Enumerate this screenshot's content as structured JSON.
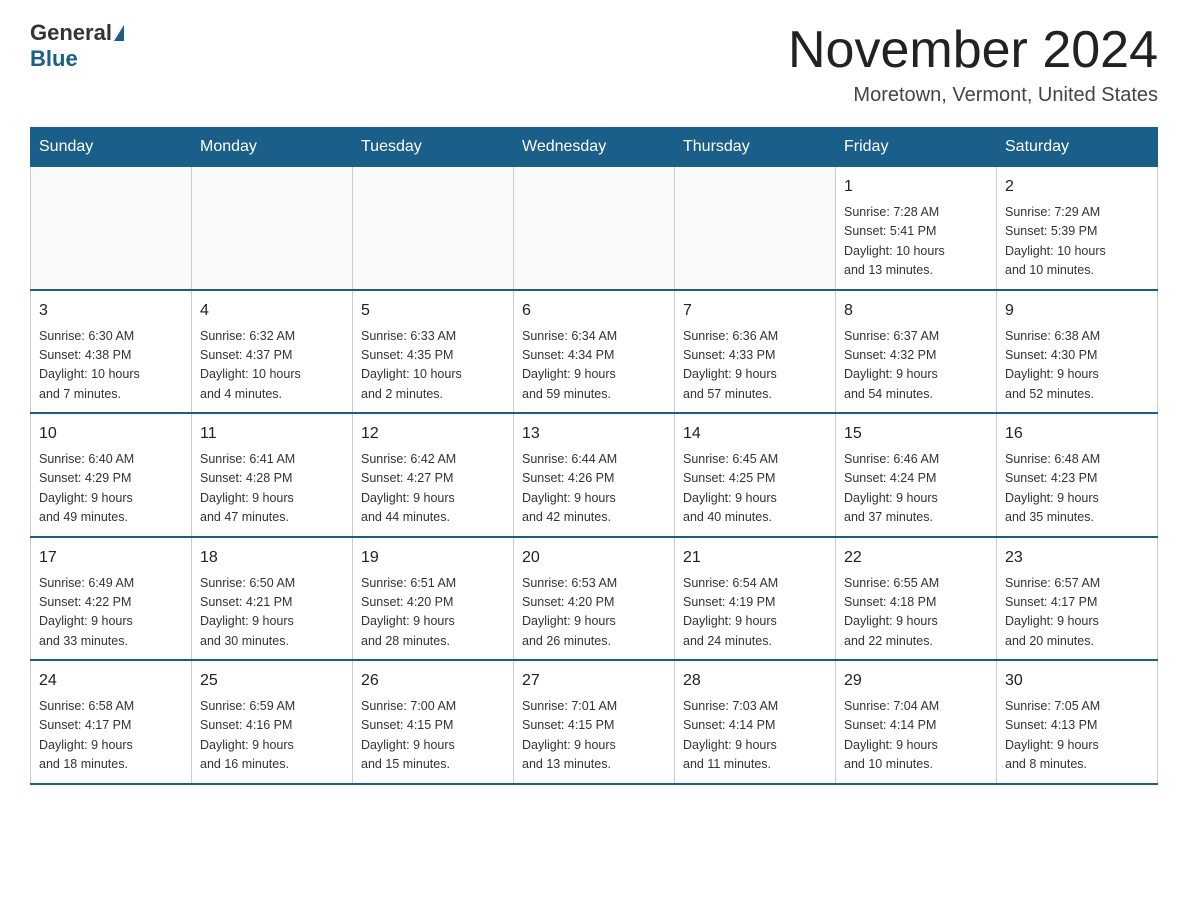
{
  "header": {
    "logo": {
      "general": "General",
      "blue": "Blue"
    },
    "title": "November 2024",
    "location": "Moretown, Vermont, United States"
  },
  "weekdays": [
    "Sunday",
    "Monday",
    "Tuesday",
    "Wednesday",
    "Thursday",
    "Friday",
    "Saturday"
  ],
  "weeks": [
    [
      {
        "day": "",
        "info": ""
      },
      {
        "day": "",
        "info": ""
      },
      {
        "day": "",
        "info": ""
      },
      {
        "day": "",
        "info": ""
      },
      {
        "day": "",
        "info": ""
      },
      {
        "day": "1",
        "info": "Sunrise: 7:28 AM\nSunset: 5:41 PM\nDaylight: 10 hours\nand 13 minutes."
      },
      {
        "day": "2",
        "info": "Sunrise: 7:29 AM\nSunset: 5:39 PM\nDaylight: 10 hours\nand 10 minutes."
      }
    ],
    [
      {
        "day": "3",
        "info": "Sunrise: 6:30 AM\nSunset: 4:38 PM\nDaylight: 10 hours\nand 7 minutes."
      },
      {
        "day": "4",
        "info": "Sunrise: 6:32 AM\nSunset: 4:37 PM\nDaylight: 10 hours\nand 4 minutes."
      },
      {
        "day": "5",
        "info": "Sunrise: 6:33 AM\nSunset: 4:35 PM\nDaylight: 10 hours\nand 2 minutes."
      },
      {
        "day": "6",
        "info": "Sunrise: 6:34 AM\nSunset: 4:34 PM\nDaylight: 9 hours\nand 59 minutes."
      },
      {
        "day": "7",
        "info": "Sunrise: 6:36 AM\nSunset: 4:33 PM\nDaylight: 9 hours\nand 57 minutes."
      },
      {
        "day": "8",
        "info": "Sunrise: 6:37 AM\nSunset: 4:32 PM\nDaylight: 9 hours\nand 54 minutes."
      },
      {
        "day": "9",
        "info": "Sunrise: 6:38 AM\nSunset: 4:30 PM\nDaylight: 9 hours\nand 52 minutes."
      }
    ],
    [
      {
        "day": "10",
        "info": "Sunrise: 6:40 AM\nSunset: 4:29 PM\nDaylight: 9 hours\nand 49 minutes."
      },
      {
        "day": "11",
        "info": "Sunrise: 6:41 AM\nSunset: 4:28 PM\nDaylight: 9 hours\nand 47 minutes."
      },
      {
        "day": "12",
        "info": "Sunrise: 6:42 AM\nSunset: 4:27 PM\nDaylight: 9 hours\nand 44 minutes."
      },
      {
        "day": "13",
        "info": "Sunrise: 6:44 AM\nSunset: 4:26 PM\nDaylight: 9 hours\nand 42 minutes."
      },
      {
        "day": "14",
        "info": "Sunrise: 6:45 AM\nSunset: 4:25 PM\nDaylight: 9 hours\nand 40 minutes."
      },
      {
        "day": "15",
        "info": "Sunrise: 6:46 AM\nSunset: 4:24 PM\nDaylight: 9 hours\nand 37 minutes."
      },
      {
        "day": "16",
        "info": "Sunrise: 6:48 AM\nSunset: 4:23 PM\nDaylight: 9 hours\nand 35 minutes."
      }
    ],
    [
      {
        "day": "17",
        "info": "Sunrise: 6:49 AM\nSunset: 4:22 PM\nDaylight: 9 hours\nand 33 minutes."
      },
      {
        "day": "18",
        "info": "Sunrise: 6:50 AM\nSunset: 4:21 PM\nDaylight: 9 hours\nand 30 minutes."
      },
      {
        "day": "19",
        "info": "Sunrise: 6:51 AM\nSunset: 4:20 PM\nDaylight: 9 hours\nand 28 minutes."
      },
      {
        "day": "20",
        "info": "Sunrise: 6:53 AM\nSunset: 4:20 PM\nDaylight: 9 hours\nand 26 minutes."
      },
      {
        "day": "21",
        "info": "Sunrise: 6:54 AM\nSunset: 4:19 PM\nDaylight: 9 hours\nand 24 minutes."
      },
      {
        "day": "22",
        "info": "Sunrise: 6:55 AM\nSunset: 4:18 PM\nDaylight: 9 hours\nand 22 minutes."
      },
      {
        "day": "23",
        "info": "Sunrise: 6:57 AM\nSunset: 4:17 PM\nDaylight: 9 hours\nand 20 minutes."
      }
    ],
    [
      {
        "day": "24",
        "info": "Sunrise: 6:58 AM\nSunset: 4:17 PM\nDaylight: 9 hours\nand 18 minutes."
      },
      {
        "day": "25",
        "info": "Sunrise: 6:59 AM\nSunset: 4:16 PM\nDaylight: 9 hours\nand 16 minutes."
      },
      {
        "day": "26",
        "info": "Sunrise: 7:00 AM\nSunset: 4:15 PM\nDaylight: 9 hours\nand 15 minutes."
      },
      {
        "day": "27",
        "info": "Sunrise: 7:01 AM\nSunset: 4:15 PM\nDaylight: 9 hours\nand 13 minutes."
      },
      {
        "day": "28",
        "info": "Sunrise: 7:03 AM\nSunset: 4:14 PM\nDaylight: 9 hours\nand 11 minutes."
      },
      {
        "day": "29",
        "info": "Sunrise: 7:04 AM\nSunset: 4:14 PM\nDaylight: 9 hours\nand 10 minutes."
      },
      {
        "day": "30",
        "info": "Sunrise: 7:05 AM\nSunset: 4:13 PM\nDaylight: 9 hours\nand 8 minutes."
      }
    ]
  ]
}
